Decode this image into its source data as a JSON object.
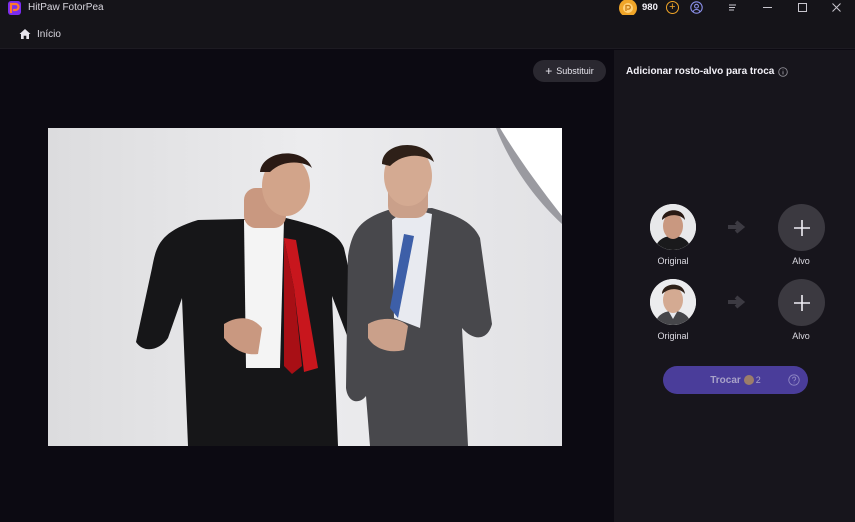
{
  "app": {
    "name": "HitPaw FotorPea",
    "coins": "980"
  },
  "nav": {
    "home_label": "Início"
  },
  "canvas": {
    "replace_label": "Substituir"
  },
  "panel": {
    "title": "Adicionar rosto-alvo para troca",
    "rows": [
      {
        "original_label": "Original",
        "target_label": "Alvo"
      },
      {
        "original_label": "Original",
        "target_label": "Alvo"
      }
    ],
    "swap_label": "Trocar",
    "swap_cost": "2"
  },
  "colors": {
    "accent": "#4a3d9a",
    "coin": "#f0a528",
    "tie_red": "#c8161d",
    "tie_blue": "#3d5fa8"
  },
  "icons": [
    "app-logo-icon",
    "coin-icon",
    "add-coin-icon",
    "account-icon",
    "menu-icon",
    "minimize-icon",
    "maximize-icon",
    "close-icon",
    "home-icon",
    "plus-icon",
    "info-icon",
    "arrow-right-icon",
    "help-icon"
  ]
}
